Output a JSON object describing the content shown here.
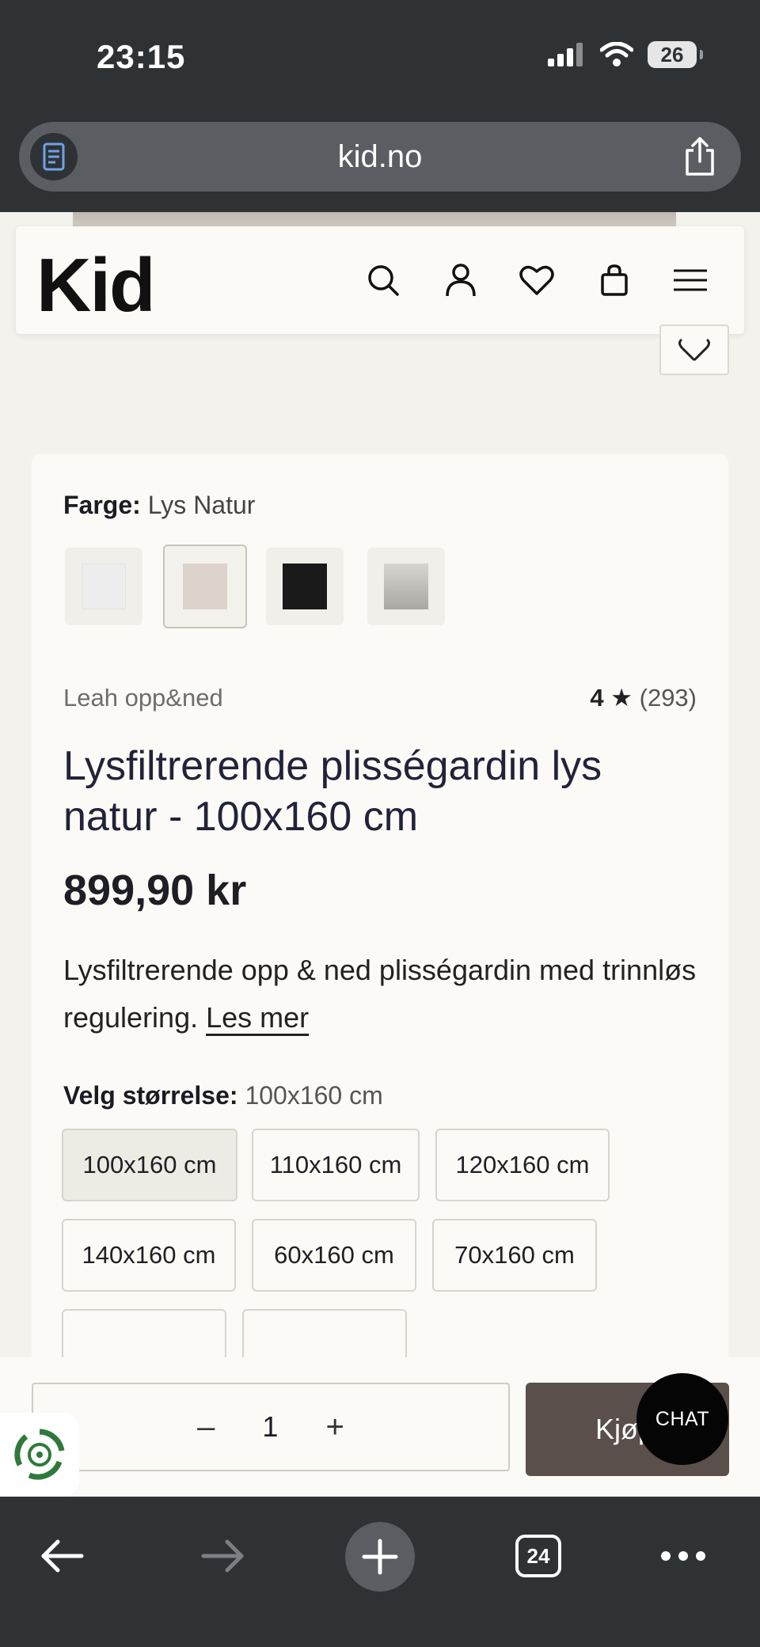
{
  "status": {
    "time": "23:15",
    "battery": "26"
  },
  "browser": {
    "url": "kid.no",
    "tabs_count": "24"
  },
  "header": {
    "logo": "Kid"
  },
  "product": {
    "color_label": "Farge:",
    "color_value": "Lys Natur",
    "swatches": [
      {
        "name": "white",
        "color": "#ededed"
      },
      {
        "name": "lys-natur",
        "color": "#dcd3cd"
      },
      {
        "name": "black",
        "color": "#1a1a1a"
      },
      {
        "name": "grey",
        "color": "#c6c4bf"
      }
    ],
    "brand": "Leah opp&ned",
    "rating": "4",
    "rating_star": "★",
    "review_count": "(293)",
    "title": "Lysfiltrerende plisségardin lys natur - 100x160 cm",
    "price": "899,90 kr",
    "description": "Lysfiltrerende opp & ned plisségardin med trinnløs regulering.",
    "read_more": "Les mer",
    "size_label": "Velg størrelse:",
    "size_value": "100x160 cm",
    "sizes": [
      "100x160 cm",
      "110x160 cm",
      "120x160 cm",
      "140x160 cm",
      "60x160 cm",
      "70x160 cm"
    ]
  },
  "buy": {
    "qty_minus": "–",
    "qty_value": "1",
    "qty_plus": "+",
    "buy_label": "Kjøp",
    "chat_label": "CHAT"
  }
}
